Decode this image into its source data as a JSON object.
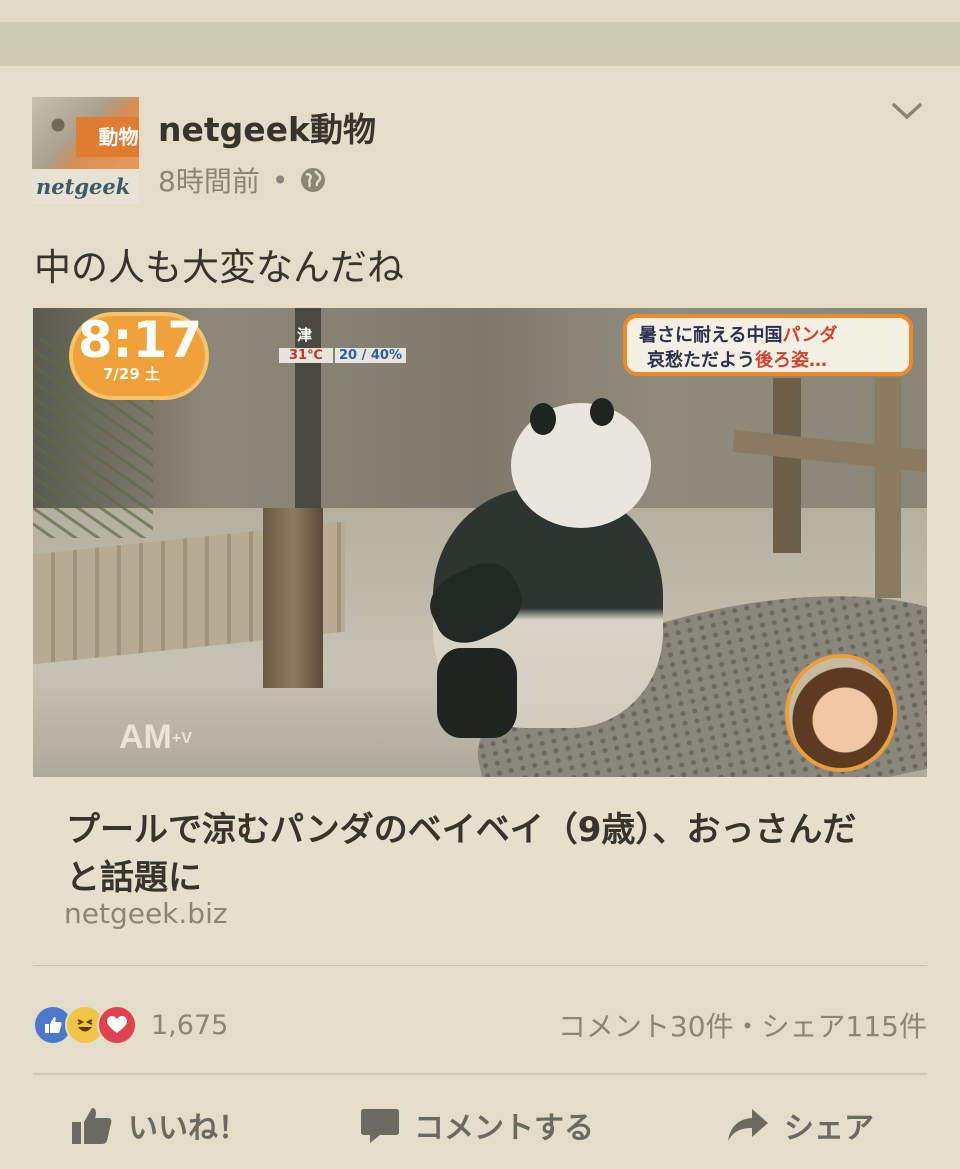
{
  "post": {
    "page_name": "netgeek動物",
    "avatar_badge": "動物",
    "avatar_logo": "netgeek",
    "time": "8時間前",
    "separator": "•",
    "text": "中の人も大変なんだね"
  },
  "media": {
    "clock_time": "8:17",
    "clock_date": "7/29 土",
    "weather_city": "津",
    "temp_high": "31℃",
    "temp_low": "20 / 40%",
    "headline_line1_a": "暑さに耐える中国",
    "headline_line1_b": "パンダ",
    "headline_line2_a": "哀愁ただよう",
    "headline_line2_b": "後ろ姿…",
    "show_logo": "AM",
    "show_logo_sub": "+V"
  },
  "link": {
    "title": "プールで涼むパンダのベイベイ（9歳）、おっさんだと話題に",
    "domain": "netgeek.biz"
  },
  "reactions": {
    "icons": [
      "like-icon",
      "haha-icon",
      "love-icon"
    ],
    "count": "1,675",
    "comments_shares": "コメント30件・シェア115件"
  },
  "actions": {
    "like_label": "いいね！",
    "comment_label": "コメントする",
    "share_label": "シェア"
  },
  "colors": {
    "background": "#e3ddca",
    "like_blue": "#4b79c9",
    "love_red": "#e0414f",
    "haha_yellow": "#f0c445",
    "clock_orange": "#f0a13a"
  }
}
